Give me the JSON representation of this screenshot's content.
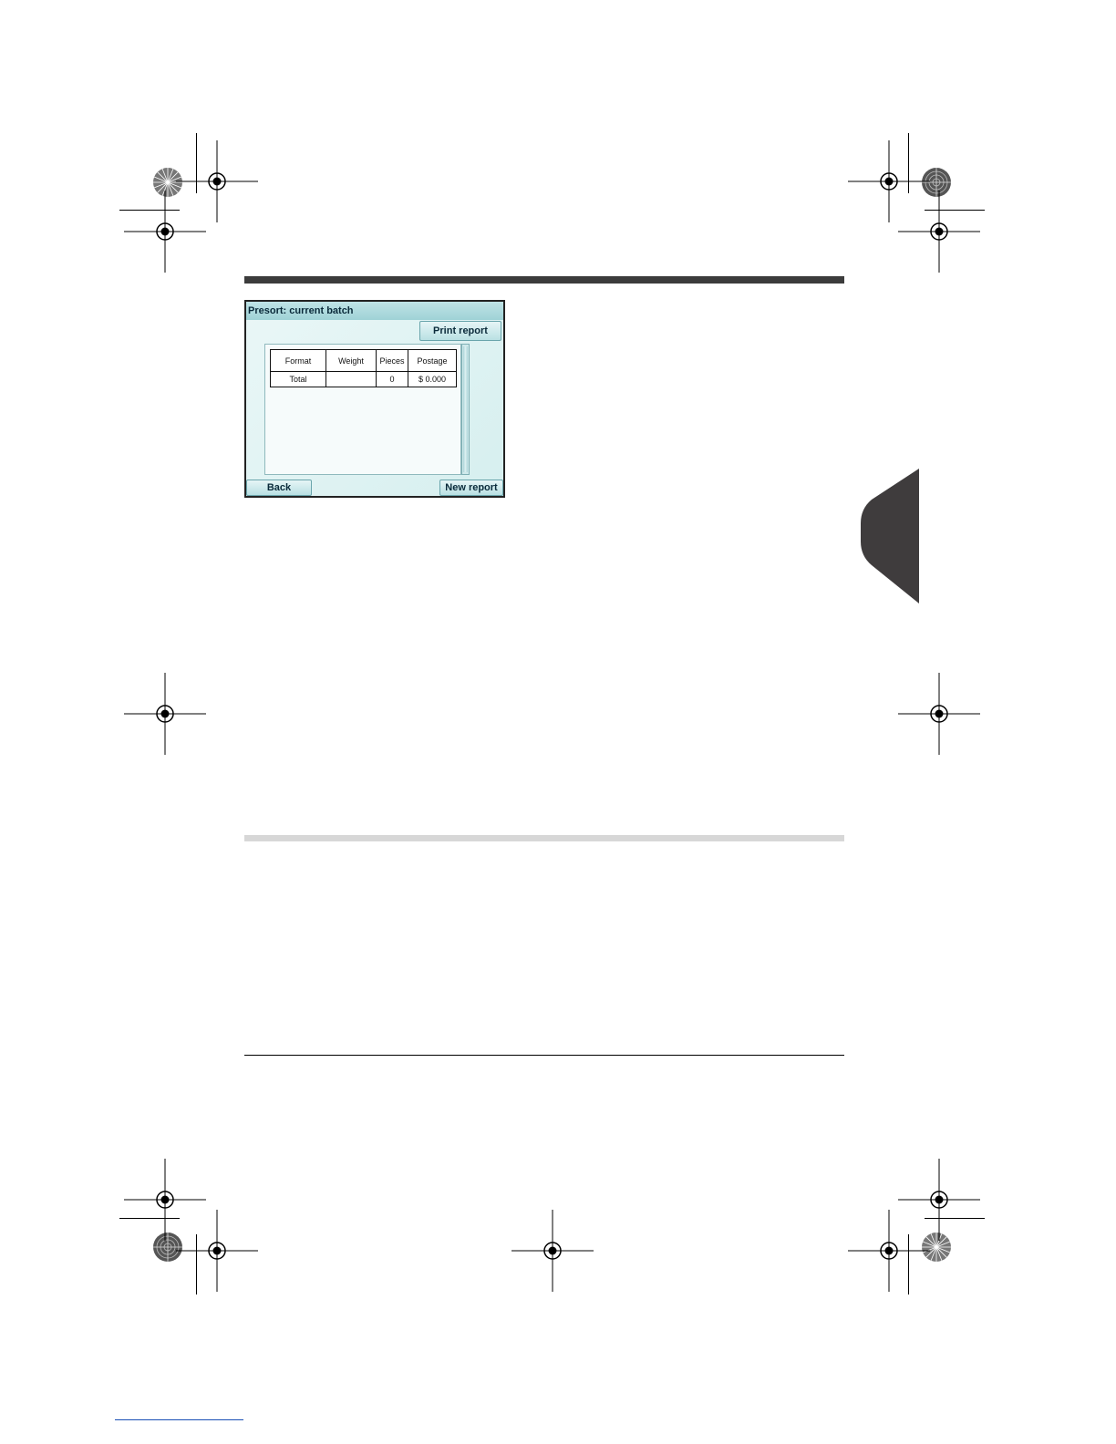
{
  "screen": {
    "title": "Presort: current batch",
    "print_report_label": "Print report",
    "back_label": "Back",
    "new_report_label": "New report",
    "table": {
      "headers": [
        "Format",
        "Weight",
        "Pieces",
        "Postage"
      ],
      "rows": [
        [
          "Total",
          "",
          "0",
          "$ 0.000"
        ]
      ]
    }
  }
}
